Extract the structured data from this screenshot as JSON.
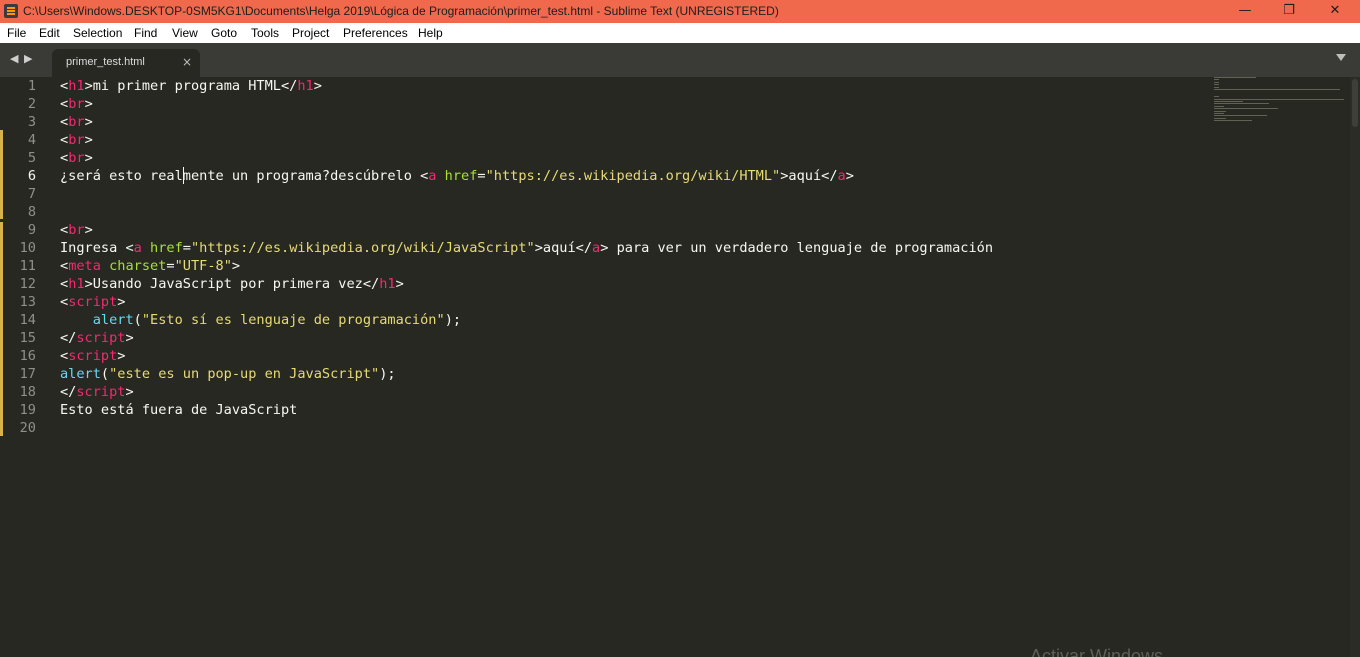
{
  "window": {
    "title": "C:\\Users\\Windows.DESKTOP-0SM5KG1\\Documents\\Helga 2019\\Lógica de Programación\\primer_test.html - Sublime Text (UNREGISTERED)",
    "minimize": "—",
    "maximize": "❐",
    "close": "✕",
    "titlebar_color": "#f0694d"
  },
  "menu": [
    "File",
    "Edit",
    "Selection",
    "Find",
    "View",
    "Goto",
    "Tools",
    "Project",
    "Preferences",
    "Help"
  ],
  "tabs": {
    "nav_back": "◀",
    "nav_forward": "▶",
    "active": {
      "label": "primer_test.html",
      "close": "×"
    },
    "overflow_icon": "chevron-down-icon"
  },
  "editor": {
    "current_line": 6,
    "theme": {
      "background": "#272822",
      "tag": "#f92672",
      "attribute": "#a6e22e",
      "string": "#e6db74",
      "function": "#66d9ef",
      "text": "#f8f8f2"
    },
    "lines": [
      {
        "n": "1",
        "tokens": [
          {
            "t": "<"
          },
          {
            "t": "h1",
            "c": "tag"
          },
          {
            "t": ">mi primer programa HTML</"
          },
          {
            "t": "h1",
            "c": "tag"
          },
          {
            "t": ">"
          }
        ]
      },
      {
        "n": "2",
        "tokens": [
          {
            "t": "<"
          },
          {
            "t": "br",
            "c": "tag"
          },
          {
            "t": ">"
          }
        ]
      },
      {
        "n": "3",
        "tokens": [
          {
            "t": "<"
          },
          {
            "t": "br",
            "c": "tag"
          },
          {
            "t": ">"
          }
        ]
      },
      {
        "n": "4",
        "tokens": [
          {
            "t": "<"
          },
          {
            "t": "br",
            "c": "tag"
          },
          {
            "t": ">"
          }
        ]
      },
      {
        "n": "5",
        "tokens": [
          {
            "t": "<"
          },
          {
            "t": "br",
            "c": "tag"
          },
          {
            "t": ">"
          }
        ]
      },
      {
        "n": "6",
        "tokens": [
          {
            "t": "¿será esto realmente un programa?descúbrelo <"
          },
          {
            "t": "a",
            "c": "tag"
          },
          {
            "t": " "
          },
          {
            "t": "href",
            "c": "attr"
          },
          {
            "t": "="
          },
          {
            "t": "\"https://es.wikipedia.org/wiki/HTML\"",
            "c": "str"
          },
          {
            "t": ">aquí</"
          },
          {
            "t": "a",
            "c": "tag"
          },
          {
            "t": ">"
          }
        ]
      },
      {
        "n": "7",
        "tokens": []
      },
      {
        "n": "8",
        "tokens": []
      },
      {
        "n": "9",
        "tokens": [
          {
            "t": "<"
          },
          {
            "t": "br",
            "c": "tag"
          },
          {
            "t": ">"
          }
        ]
      },
      {
        "n": "10",
        "tokens": [
          {
            "t": "Ingresa <"
          },
          {
            "t": "a",
            "c": "tag"
          },
          {
            "t": " "
          },
          {
            "t": "href",
            "c": "attr"
          },
          {
            "t": "="
          },
          {
            "t": "\"https://es.wikipedia.org/wiki/JavaScript\"",
            "c": "str"
          },
          {
            "t": ">aquí</"
          },
          {
            "t": "a",
            "c": "tag"
          },
          {
            "t": "> para ver un verdadero lenguaje de programación"
          }
        ]
      },
      {
        "n": "11",
        "tokens": [
          {
            "t": "<"
          },
          {
            "t": "meta",
            "c": "tag"
          },
          {
            "t": " "
          },
          {
            "t": "charset",
            "c": "attr"
          },
          {
            "t": "="
          },
          {
            "t": "\"UTF-8\"",
            "c": "str"
          },
          {
            "t": ">"
          }
        ]
      },
      {
        "n": "12",
        "tokens": [
          {
            "t": "<"
          },
          {
            "t": "h1",
            "c": "tag"
          },
          {
            "t": ">Usando JavaScript por primera vez</"
          },
          {
            "t": "h1",
            "c": "tag"
          },
          {
            "t": ">"
          }
        ]
      },
      {
        "n": "13",
        "tokens": [
          {
            "t": "<"
          },
          {
            "t": "script",
            "c": "tag"
          },
          {
            "t": ">"
          }
        ]
      },
      {
        "n": "14",
        "tokens": [
          {
            "t": "    "
          },
          {
            "t": "alert",
            "c": "fn"
          },
          {
            "t": "("
          },
          {
            "t": "\"Esto sí es lenguaje de programación\"",
            "c": "str"
          },
          {
            "t": ");"
          }
        ]
      },
      {
        "n": "15",
        "tokens": [
          {
            "t": "</"
          },
          {
            "t": "script",
            "c": "tag"
          },
          {
            "t": ">"
          }
        ]
      },
      {
        "n": "16",
        "tokens": [
          {
            "t": "<"
          },
          {
            "t": "script",
            "c": "tag"
          },
          {
            "t": ">"
          }
        ]
      },
      {
        "n": "17",
        "tokens": [
          {
            "t": "alert",
            "c": "fn"
          },
          {
            "t": "("
          },
          {
            "t": "\"este es un pop-up en JavaScript\"",
            "c": "str"
          },
          {
            "t": ");"
          }
        ]
      },
      {
        "n": "18",
        "tokens": [
          {
            "t": "</"
          },
          {
            "t": "script",
            "c": "tag"
          },
          {
            "t": ">"
          }
        ]
      },
      {
        "n": "19",
        "tokens": [
          {
            "t": "Esto está fuera de JavaScript"
          }
        ]
      },
      {
        "n": "20",
        "tokens": []
      }
    ]
  },
  "watermark": "Activar Windows"
}
